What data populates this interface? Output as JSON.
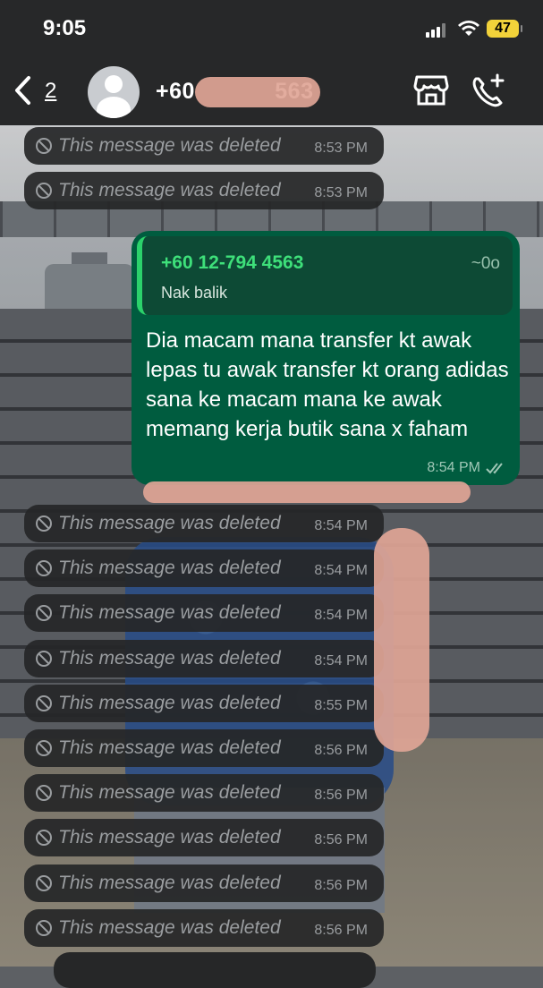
{
  "status_bar": {
    "time": "9:05",
    "battery": "47"
  },
  "header": {
    "back_count": "2",
    "contact_name": "+60            563"
  },
  "messages_before": [
    {
      "text": "This message was deleted",
      "time": "8:53 PM"
    },
    {
      "text": "This message was deleted",
      "time": "8:53 PM"
    }
  ],
  "bubble": {
    "quote_name": "+60 12-794 4563",
    "quote_handle": "~0o",
    "quote_text": "Nak balik",
    "text": "Dia macam mana transfer kt awak lepas tu awak transfer kt orang adidas sana ke macam mana ke awak memang kerja butik sana x faham",
    "time": "8:54 PM"
  },
  "messages_after": [
    {
      "text": "This message was deleted",
      "time": "8:54 PM"
    },
    {
      "text": "This message was deleted",
      "time": "8:54 PM"
    },
    {
      "text": "This message was deleted",
      "time": "8:54 PM"
    },
    {
      "text": "This message was deleted",
      "time": "8:54 PM"
    },
    {
      "text": "This message was deleted",
      "time": "8:55 PM"
    },
    {
      "text": "This message was deleted",
      "time": "8:56 PM"
    },
    {
      "text": "This message was deleted",
      "time": "8:56 PM"
    },
    {
      "text": "This message was deleted",
      "time": "8:56 PM"
    },
    {
      "text": "This message was deleted",
      "time": "8:56 PM"
    },
    {
      "text": "This message was deleted",
      "time": "8:56 PM"
    }
  ],
  "icons": {
    "back": "chevron-left-icon",
    "shop": "storefront-icon",
    "call": "phone-plus-icon",
    "deleted": "ban-icon",
    "read": "double-check-icon"
  },
  "colors": {
    "bubble": "#005c3f",
    "quote_accent": "#2bd26b",
    "battery": "#f2d23a",
    "deleted_bg": "#262728"
  }
}
